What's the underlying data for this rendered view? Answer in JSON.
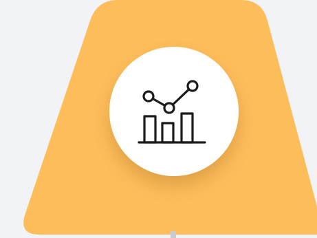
{
  "card": {
    "icon": "analytics-chart-icon",
    "colors": {
      "background": "#f1f3f6",
      "shape": "#fdbd5b",
      "circle": "#ffffff",
      "icon_stroke": "#1b1b1b",
      "connector": "#c9cbd0"
    }
  }
}
